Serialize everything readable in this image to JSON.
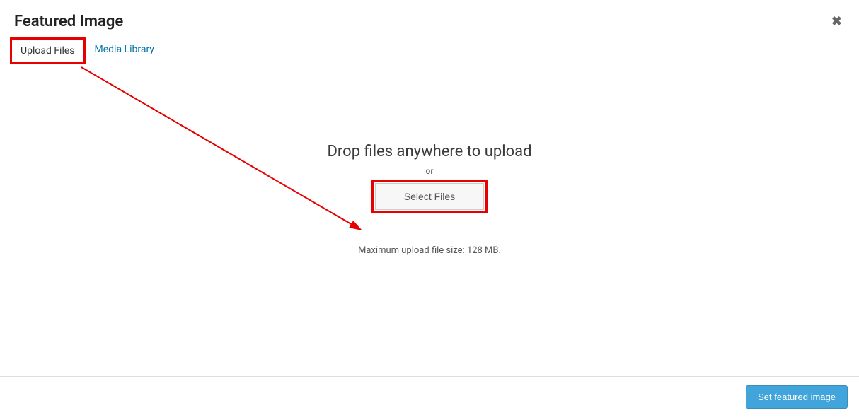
{
  "modal": {
    "title": "Featured Image",
    "close_label": "✖"
  },
  "tabs": {
    "upload": "Upload Files",
    "library": "Media Library"
  },
  "uploader": {
    "heading": "Drop files anywhere to upload",
    "or": "or",
    "select_button": "Select Files",
    "max_size": "Maximum upload file size: 128 MB."
  },
  "footer": {
    "set_button": "Set featured image"
  }
}
